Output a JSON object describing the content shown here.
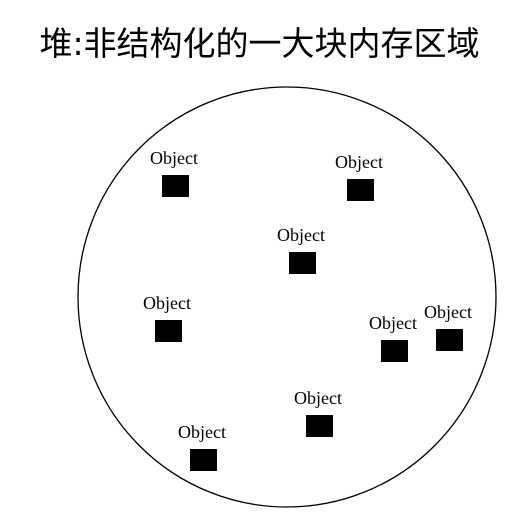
{
  "title": "堆:非结构化的一大块内存区域",
  "colors": {
    "stroke": "#000000",
    "block": "#000000",
    "background": "#ffffff"
  },
  "objects": [
    {
      "label": "Object"
    },
    {
      "label": "Object"
    },
    {
      "label": "Object"
    },
    {
      "label": "Object"
    },
    {
      "label": "Object"
    },
    {
      "label": "Object"
    },
    {
      "label": "Object"
    },
    {
      "label": "Object"
    }
  ]
}
